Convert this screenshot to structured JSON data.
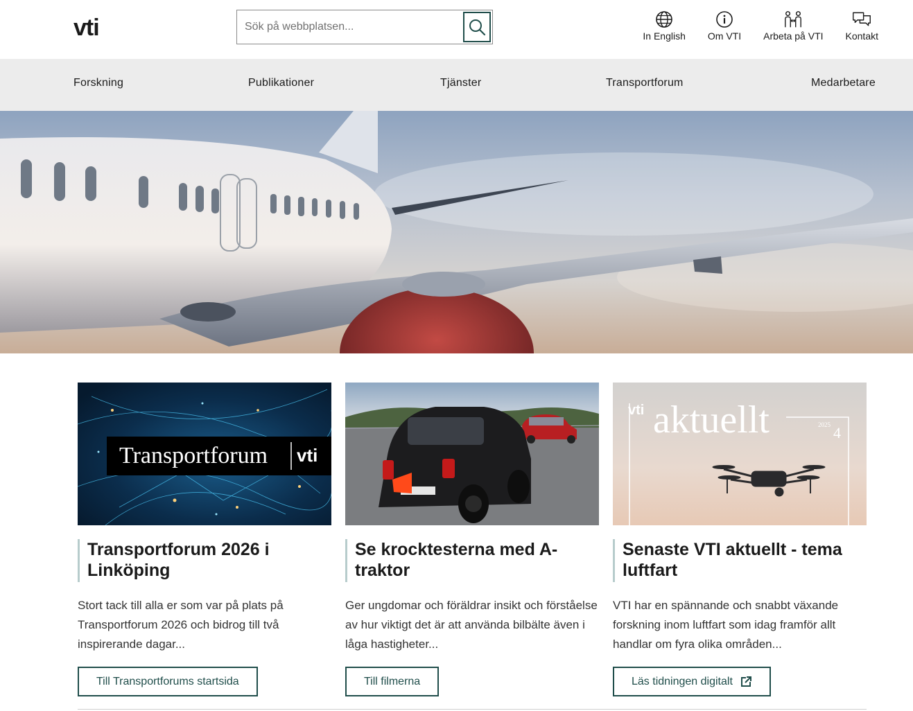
{
  "header": {
    "logo": "vti",
    "search": {
      "placeholder": "Sök på webbplatsen...",
      "value": ""
    },
    "util_nav": [
      {
        "label": "In English",
        "icon": "globe-icon"
      },
      {
        "label": "Om VTI",
        "icon": "info-icon"
      },
      {
        "label": "Arbeta på VTI",
        "icon": "people-icon"
      },
      {
        "label": "Kontakt",
        "icon": "chat-icon"
      }
    ]
  },
  "main_nav": [
    "Forskning",
    "Publikationer",
    "Tjänster",
    "Transportforum",
    "Medarbetare"
  ],
  "hero": {
    "image": "airplane-wing-photo"
  },
  "cards": [
    {
      "image_text": "Transportforum",
      "image_logo": "vti",
      "title": "Transportforum 2026 i Linköping",
      "text": "Stort tack till alla er som var på plats på Transportforum 2026 och bidrog till två inspirerande dagar...",
      "button": "Till Transportforums startsida"
    },
    {
      "image": "crash-test-cars-photo",
      "title": "Se krocktesterna med A-traktor",
      "text": "Ger ungdomar och föräldrar insikt och förståelse av hur viktigt det är att använda bilbälte även i låga hastigheter...",
      "button": "Till filmerna"
    },
    {
      "image_logo": "vti",
      "image_text": "aktuellt",
      "image_issue_year": "2025",
      "image_issue_no": "4",
      "title": "Senaste VTI aktuellt - tema luftfart",
      "text": "VTI har en spännande och snabbt växande forskning inom luftfart som idag framför allt handlar om fyra olika områden...",
      "button": "Läs tidningen digitalt",
      "button_icon": "external-link-icon"
    }
  ],
  "colors": {
    "accent": "#1f4d4a",
    "nav_bg": "#ececec",
    "title_rule": "#b7cccc"
  }
}
